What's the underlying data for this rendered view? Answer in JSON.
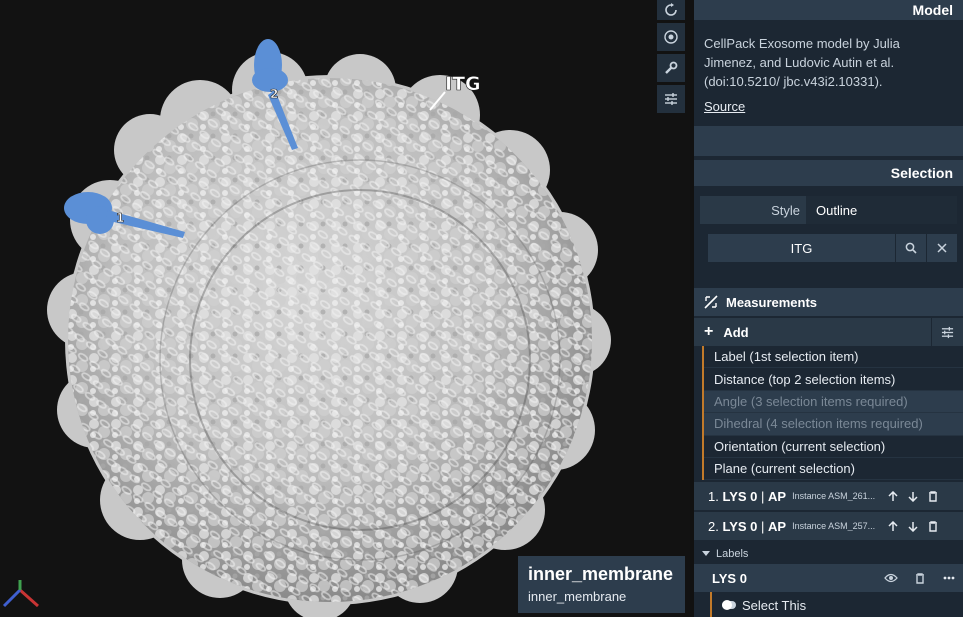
{
  "viewport": {
    "tags": {
      "itg": "ITG",
      "one": "1",
      "two": "2"
    },
    "hover": {
      "title": "inner_membrane",
      "subtitle": "inner_membrane"
    }
  },
  "toolbar": [
    "reset-camera-icon",
    "snapshot-icon",
    "wrench-icon",
    "sliders-icon"
  ],
  "model": {
    "header": "Model",
    "description": "CellPack Exosome model by Julia Jimenez, and Ludovic Autin et al. (doi:10.5210/ jbc.v43i2.10331).",
    "source_link": "Source"
  },
  "selection": {
    "header": "Selection",
    "style_label": "Style",
    "style_value": "Outline",
    "search_value": "ITG"
  },
  "measurements": {
    "header": "Measurements",
    "add_label": "Add",
    "options": [
      {
        "label": "Label (1st selection item)",
        "enabled": true
      },
      {
        "label": "Distance (top 2 selection items)",
        "enabled": true
      },
      {
        "label": "Angle (3 selection items required)",
        "enabled": false
      },
      {
        "label": "Dihedral (4 selection items required)",
        "enabled": false
      },
      {
        "label": "Orientation (current selection)",
        "enabled": true
      },
      {
        "label": "Plane (current selection)",
        "enabled": true
      }
    ],
    "items": [
      {
        "index": "1.",
        "residue": "LYS 0",
        "chain": "AP",
        "instance": "Instance ASM_261..."
      },
      {
        "index": "2.",
        "residue": "LYS 0",
        "chain": "AP",
        "instance": "Instance ASM_257..."
      }
    ],
    "separator": "|"
  },
  "labels": {
    "header": "Labels",
    "entry": "LYS 0",
    "select_this": "Select This"
  },
  "colors": {
    "accent": "#c27a2a",
    "highlight": "#5b8fd6",
    "panel": "#1c2733",
    "header": "#2d3d4d"
  }
}
